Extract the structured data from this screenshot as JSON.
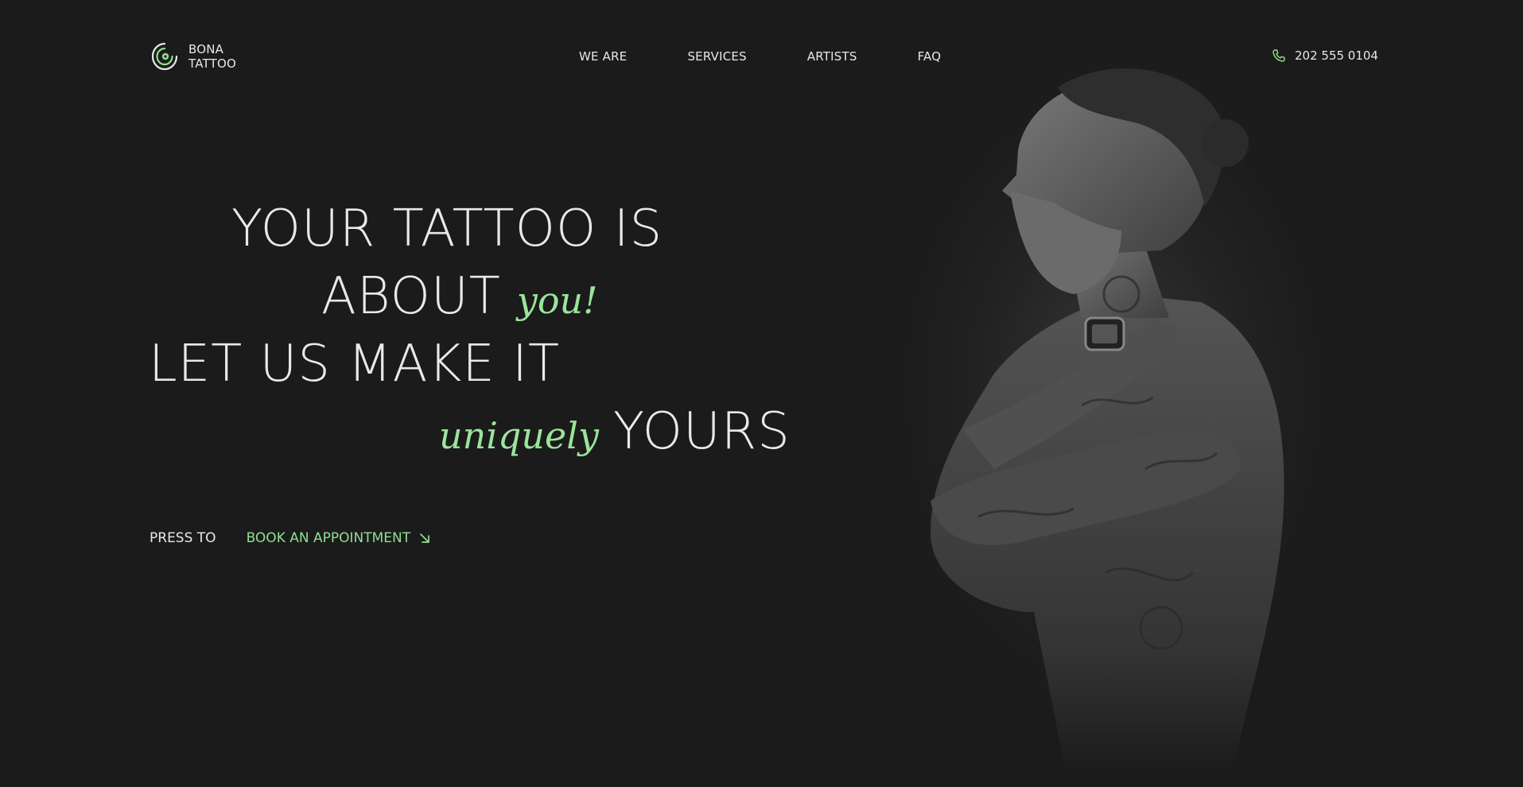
{
  "brand": {
    "line1": "BONA",
    "line2": "TATTOO",
    "logo_icon": "spiral-logo-icon",
    "accent_color": "#8fe08e"
  },
  "nav": {
    "items": [
      {
        "label": "WE ARE"
      },
      {
        "label": "SERVICES"
      },
      {
        "label": "ARTISTS"
      },
      {
        "label": "FAQ"
      }
    ]
  },
  "contact": {
    "phone": "202 555 0104",
    "phone_icon": "phone-icon"
  },
  "hero": {
    "line1": "YOUR TATTOO IS",
    "line2_main": "ABOUT",
    "line2_script": "you!",
    "line3": "LET US MAKE IT",
    "line4_script": "uniquely",
    "line4_main": "YOURS"
  },
  "cta": {
    "press_label": "PRESS TO",
    "book_label": "BOOK AN APPOINTMENT",
    "arrow_icon": "arrow-down-right-icon"
  },
  "image": {
    "portrait_icon": "tattooed-man-portrait"
  }
}
